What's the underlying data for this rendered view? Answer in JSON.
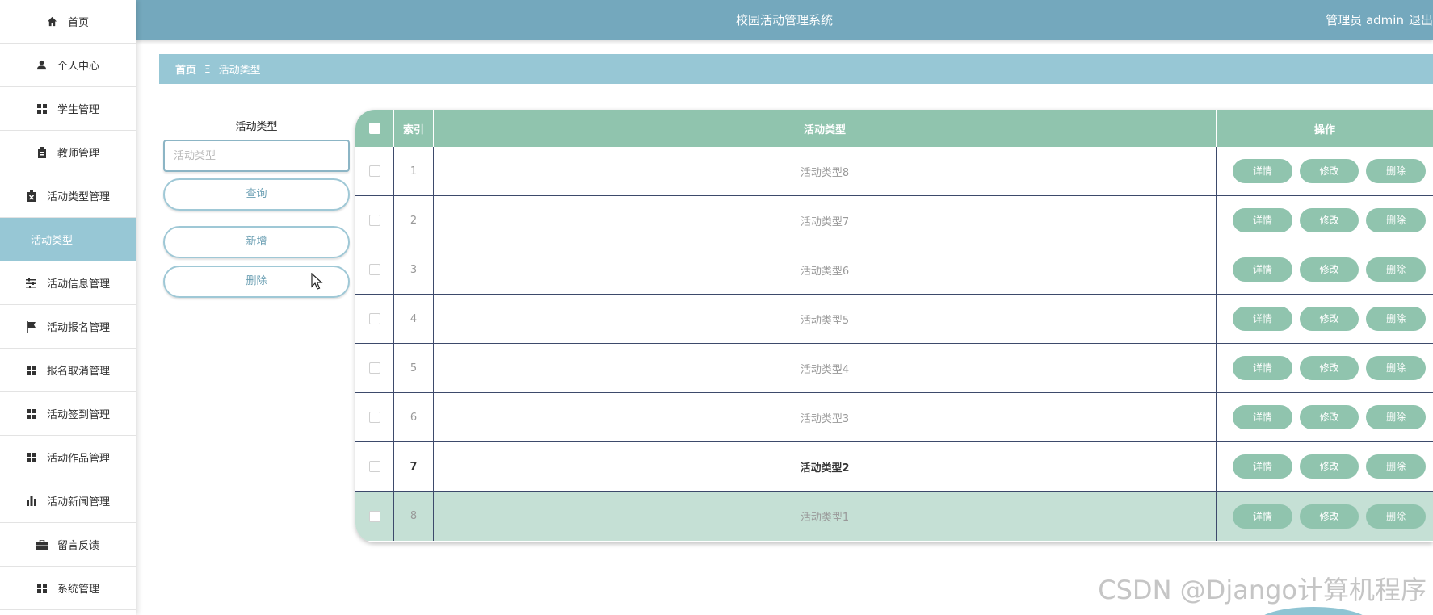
{
  "header": {
    "title": "校园活动管理系统",
    "user_label": "管理员 admin",
    "logout_label": "退出"
  },
  "sidebar": {
    "items": [
      {
        "label": "首页",
        "icon": "home-icon"
      },
      {
        "label": "个人中心",
        "icon": "person-icon"
      },
      {
        "label": "学生管理",
        "icon": "grid-icon"
      },
      {
        "label": "教师管理",
        "icon": "clipboard-icon"
      },
      {
        "label": "活动类型管理",
        "icon": "clipboard-x-icon"
      },
      {
        "label": "活动类型",
        "icon": "",
        "submenu": true,
        "active": true
      },
      {
        "label": "活动信息管理",
        "icon": "sliders-icon"
      },
      {
        "label": "活动报名管理",
        "icon": "flag-icon"
      },
      {
        "label": "报名取消管理",
        "icon": "grid-icon"
      },
      {
        "label": "活动签到管理",
        "icon": "grid-icon"
      },
      {
        "label": "活动作品管理",
        "icon": "grid-icon"
      },
      {
        "label": "活动新闻管理",
        "icon": "bar-chart-icon"
      },
      {
        "label": "留言反馈",
        "icon": "briefcase-icon"
      },
      {
        "label": "系统管理",
        "icon": "grid-icon"
      }
    ]
  },
  "breadcrumb": {
    "home": "首页",
    "separator": "Ξ",
    "current": "活动类型"
  },
  "search": {
    "label": "活动类型",
    "placeholder": "活动类型",
    "value": "",
    "query_label": "查询",
    "add_label": "新增",
    "delete_label": "删除"
  },
  "table": {
    "columns": [
      "索引",
      "活动类型",
      "操作"
    ],
    "rows": [
      {
        "index": "1",
        "type": "活动类型8"
      },
      {
        "index": "2",
        "type": "活动类型7"
      },
      {
        "index": "3",
        "type": "活动类型6"
      },
      {
        "index": "4",
        "type": "活动类型5"
      },
      {
        "index": "5",
        "type": "活动类型4"
      },
      {
        "index": "6",
        "type": "活动类型3"
      },
      {
        "index": "7",
        "type": "活动类型2"
      },
      {
        "index": "8",
        "type": "活动类型1"
      }
    ],
    "actions": {
      "detail": "详情",
      "edit": "修改",
      "delete": "删除"
    }
  },
  "watermark": "CSDN @Django计算机程序",
  "colors": {
    "header": "#74a8bd",
    "accent": "#97c7d5",
    "table_green": "#90c4ae",
    "row_highlight": "#c5e0d5"
  }
}
